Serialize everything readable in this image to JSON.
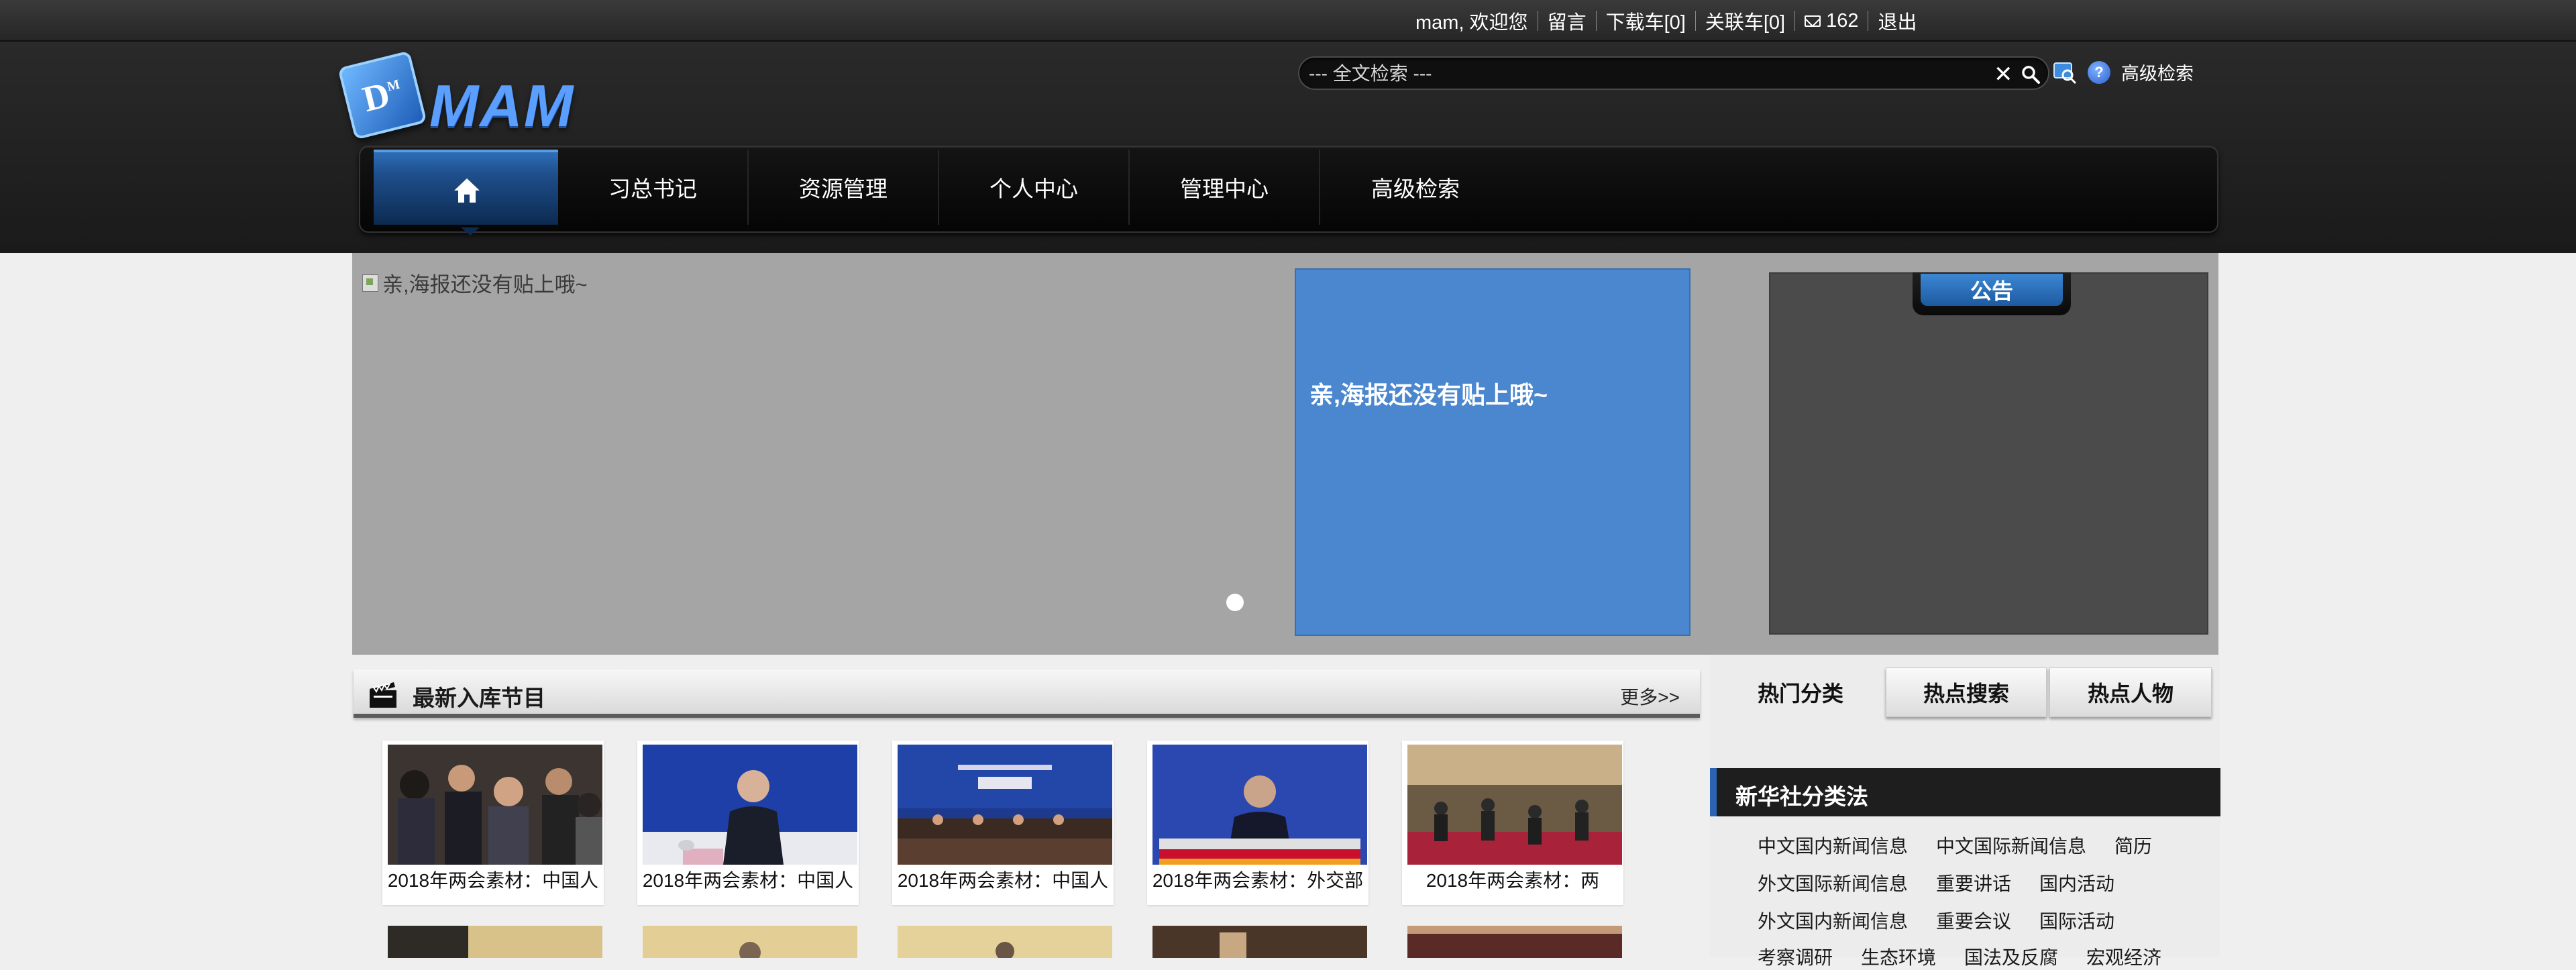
{
  "topbar": {
    "welcome": "mam, 欢迎您",
    "message": "留言",
    "download_cart": "下载车[0]",
    "link_cart": "关联车[0]",
    "mail_count": "162",
    "logout": "退出"
  },
  "header": {
    "logo_text": "MAM",
    "logo_badge": "D",
    "search_placeholder": "--- 全文检索 ---",
    "advanced_search": "高级检索"
  },
  "nav": {
    "items": [
      "习总书记",
      "资源管理",
      "个人中心",
      "管理中心",
      "高级检索"
    ]
  },
  "banner": {
    "poster_alt": "亲,海报还没有贴上哦~",
    "poster_text": "亲,海报还没有贴上哦~",
    "notice_label": "公告"
  },
  "latest": {
    "title": "最新入库节目",
    "more": "更多>>",
    "items": [
      {
        "caption": "2018年两会素材：中国人"
      },
      {
        "caption": "2018年两会素材：中国人"
      },
      {
        "caption": "2018年两会素材：中国人"
      },
      {
        "caption": "2018年两会素材：外交部"
      },
      {
        "caption": "2018年两会素材：两"
      }
    ]
  },
  "right": {
    "tabs": [
      "热门分类",
      "热点搜索",
      "热点人物"
    ],
    "category_title": "新华社分类法",
    "rows": [
      [
        "中文国内新闻信息",
        "中文国际新闻信息",
        "简历"
      ],
      [
        "外文国际新闻信息",
        "重要讲话",
        "国内活动"
      ],
      [
        "外文国内新闻信息",
        "重要会议",
        "国际活动"
      ],
      [
        "考察调研",
        "生态环境",
        "国法及反腐",
        "宏观经济"
      ]
    ]
  },
  "colors": {
    "accent_blue": "#2d6eb8",
    "poster_blue": "#4b87cf",
    "banner_gray": "#a5a5a5",
    "notice_gray": "#4b4b4b"
  }
}
